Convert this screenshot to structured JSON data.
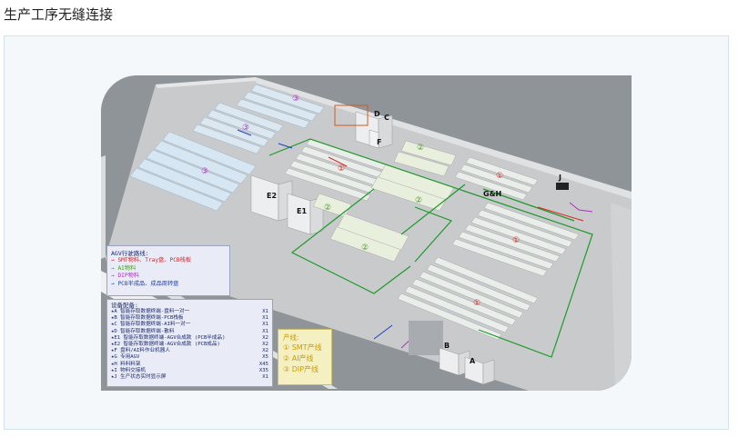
{
  "page": {
    "title": "生产工序无缝连接"
  },
  "map_labels": {
    "zone_D": "D",
    "zone_C": "C",
    "zone_F": "F",
    "zone_GH": "G&H",
    "zone_J": "J",
    "zone_E1": "E1",
    "zone_E2": "E2",
    "zone_B": "B",
    "zone_A": "A",
    "circle_1": "①",
    "circle_2": "②",
    "circle_3": "③"
  },
  "agv_routes": {
    "title": "AGV行驶路线:",
    "items": [
      {
        "text": "→ SMT物料、Tray盘、PCB栈板",
        "color": "#e02020"
      },
      {
        "text": "→ AI物料",
        "color": "#4a9a2a"
      },
      {
        "text": "→ DIP物料",
        "color": "#b030c0"
      },
      {
        "text": "→ PCB半成品、成品周转盘",
        "color": "#1d3fbf"
      }
    ]
  },
  "equipment": {
    "title": "设备配备:",
    "items": [
      {
        "label": "★A 智能存取数据终端-盘料一对一",
        "qty": "X1"
      },
      {
        "label": "★B 智能存取数据终端-PCB栈板",
        "qty": "X1"
      },
      {
        "label": "★C 智能存取数据终端-AI料一对一",
        "qty": "X1"
      },
      {
        "label": "★D 智能存取数据终端-散料",
        "qty": "X1"
      },
      {
        "label": "★E1 智能存取数据终端-AGV合成款 (PCB半成品)",
        "qty": "X2"
      },
      {
        "label": "★E2 智能存取数据终端-AGV合成款 (PCB成品)",
        "qty": "X2"
      },
      {
        "label": "★F 盘料/AI料作业机器人",
        "qty": "X2"
      },
      {
        "label": "★G 专用AGV",
        "qty": "X5"
      },
      {
        "label": "★H 料料料架",
        "qty": "X45"
      },
      {
        "label": "★I 物料交接机",
        "qty": "X35"
      },
      {
        "label": "★J 生产状态实时显示屏",
        "qty": "X1"
      }
    ]
  },
  "production_lines": {
    "title": "产线:",
    "items": [
      {
        "text": "① SMT产线"
      },
      {
        "text": "② AI产线"
      },
      {
        "text": "③ DIP产线"
      }
    ]
  },
  "colors": {
    "floor": "#c9cbcd",
    "outer": "#8e9497",
    "wall": "#e7e9ea",
    "machine": "#e8eeea",
    "machine_blue": "#d4e4f0",
    "route_green": "#1e9a2a",
    "route_red": "#e02020",
    "route_blue": "#1d3fbf",
    "route_purple": "#b030c0"
  }
}
